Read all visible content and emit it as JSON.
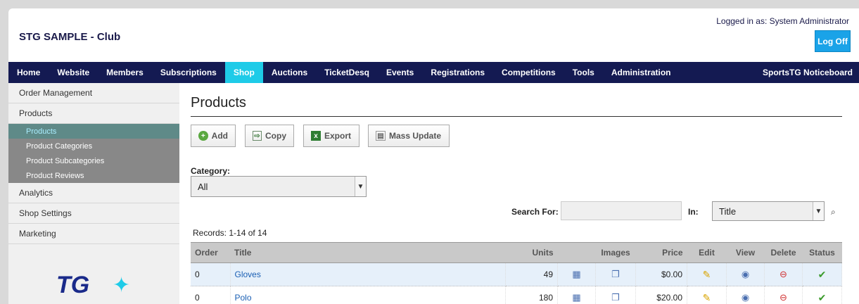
{
  "header": {
    "app_title": "STG SAMPLE - Club",
    "login_info": "Logged in as: System Administrator",
    "logoff_label": "Log Off"
  },
  "nav": {
    "items": [
      "Home",
      "Website",
      "Members",
      "Subscriptions",
      "Shop",
      "Auctions",
      "TicketDesq",
      "Events",
      "Registrations",
      "Competitions",
      "Tools",
      "Administration"
    ],
    "active": "Shop",
    "right": "SportsTG Noticeboard"
  },
  "sidebar": {
    "order_management": "Order Management",
    "products": "Products",
    "sub": [
      "Products",
      "Product Categories",
      "Product Subcategories",
      "Product Reviews"
    ],
    "analytics": "Analytics",
    "shop_settings": "Shop Settings",
    "marketing": "Marketing",
    "logo_text": "TG"
  },
  "main": {
    "title": "Products",
    "toolbar": {
      "add": "Add",
      "copy": "Copy",
      "export": "Export",
      "mass_update": "Mass Update"
    },
    "category_label": "Category:",
    "category_value": "All",
    "search_label": "Search For:",
    "search_value": "",
    "in_label": "In:",
    "in_value": "Title",
    "records": "Records: 1-14 of 14",
    "columns": [
      "Order",
      "Title",
      "Units",
      "",
      "Images",
      "Price",
      "Edit",
      "View",
      "Delete",
      "Status"
    ],
    "rows": [
      {
        "order": "0",
        "title": "Gloves",
        "units": "49",
        "price": "$0.00"
      },
      {
        "order": "0",
        "title": "Polo",
        "units": "180",
        "price": "$20.00"
      }
    ]
  },
  "colors": {
    "nav_bg": "#141a52",
    "nav_active": "#1ecbe8",
    "logoff": "#1aa3e8"
  }
}
